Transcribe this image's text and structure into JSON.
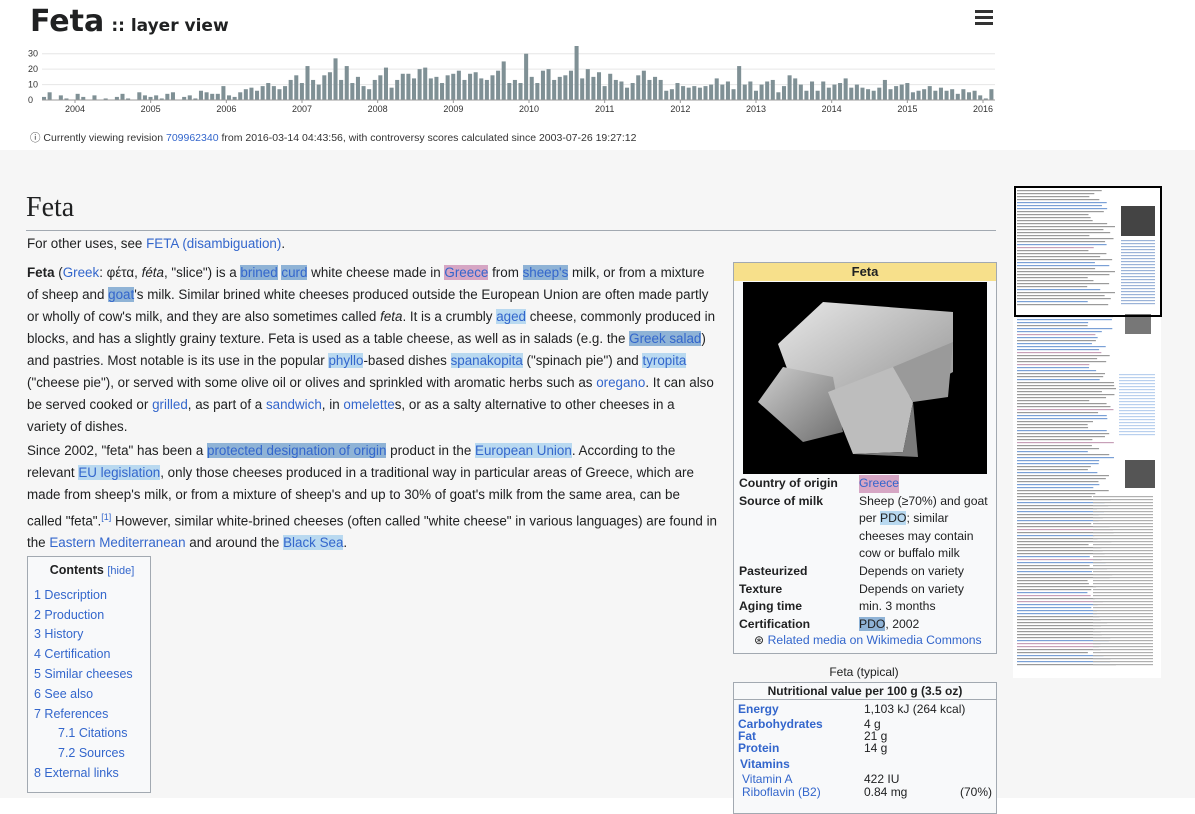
{
  "header": {
    "title": "Feta",
    "subtitle": ":: layer view",
    "menu_icon": "hamburger-menu-icon",
    "revision": {
      "info_icon": "ⓘ",
      "prefix": "Currently viewing revision",
      "id": "709962340",
      "suffix": "from 2016-03-14 04:43:56, with controversy scores calculated since 2003-07-26 19:27:12"
    }
  },
  "chart_data": {
    "type": "bar",
    "ylim": [
      0,
      35
    ],
    "y_ticks": [
      "30",
      "20",
      "10",
      "0"
    ],
    "x_ticks": [
      "2004",
      "2005",
      "2006",
      "2007",
      "2008",
      "2009",
      "2010",
      "2011",
      "2012",
      "2013",
      "2014",
      "2015",
      "2016"
    ],
    "bar_color": "#7f9095",
    "grid": true,
    "values": [
      2,
      5,
      0,
      3,
      1,
      0,
      4,
      2,
      0,
      3,
      0,
      1,
      0,
      2,
      4,
      1,
      0,
      5,
      3,
      2,
      3,
      1,
      4,
      5,
      0,
      2,
      3,
      1,
      6,
      5,
      4,
      4,
      9,
      3,
      2,
      5,
      7,
      8,
      6,
      9,
      11,
      9,
      7,
      9,
      13,
      16,
      11,
      22,
      13,
      10,
      16,
      18,
      27,
      13,
      22,
      11,
      15,
      9,
      7,
      13,
      16,
      21,
      8,
      13,
      17,
      17,
      14,
      20,
      21,
      14,
      15,
      11,
      16,
      17,
      19,
      13,
      17,
      18,
      14,
      13,
      16,
      19,
      25,
      11,
      13,
      11,
      30,
      15,
      11,
      19,
      20,
      13,
      15,
      16,
      19,
      35,
      14,
      20,
      15,
      18,
      9,
      17,
      13,
      12,
      8,
      11,
      16,
      19,
      13,
      15,
      13,
      6,
      7,
      11,
      9,
      8,
      9,
      8,
      9,
      10,
      14,
      10,
      12,
      7,
      22,
      10,
      12,
      6,
      10,
      12,
      13,
      5,
      9,
      16,
      14,
      10,
      6,
      12,
      6,
      12,
      8,
      10,
      11,
      14,
      8,
      10,
      8,
      7,
      6,
      8,
      13,
      7,
      9,
      10,
      11,
      5,
      6,
      7,
      9,
      6,
      8,
      6,
      7,
      4,
      7,
      5,
      6,
      3,
      1,
      7
    ]
  },
  "article": {
    "title": "Feta",
    "hatnote_prefix": "For other uses, see",
    "hatnote_link": "FETA (disambiguation)",
    "hatnote_end": "."
  },
  "toc": {
    "title": "Contents",
    "hide": "[hide]",
    "items": [
      "1 Description",
      "2 Production",
      "3 History",
      "4 Certification",
      "5 Similar cheeses",
      "6 See also",
      "7 References",
      "7.1 Citations",
      "7.2 Sources",
      "8 External links"
    ]
  },
  "infobox": {
    "title": "Feta",
    "rows": [
      {
        "k": "Country of origin",
        "v": "Greece"
      },
      {
        "k": "Source of milk",
        "v": "Sheep (≥70%) and goat per PDO; similar cheeses may contain cow or buffalo milk"
      },
      {
        "k": "Pasteurized",
        "v": "Depends on variety"
      },
      {
        "k": "Texture",
        "v": "Depends on variety"
      },
      {
        "k": "Aging time",
        "v": "min. 3 months"
      },
      {
        "k": "Certification",
        "v": "PDO, 2002"
      }
    ],
    "commons": "Related media on Wikimedia Commons"
  },
  "nutrition": {
    "caption": "Feta (typical)",
    "header": "Nutritional value per 100 g (3.5 oz)",
    "rows": [
      {
        "k": "Energy",
        "v": "1,103 kJ (264 kcal)",
        "p": ""
      },
      {
        "k": "Carbohydrates",
        "v": "4 g",
        "p": ""
      },
      {
        "k": "Fat",
        "v": "21 g",
        "p": ""
      },
      {
        "k": "Protein",
        "v": "14 g",
        "p": ""
      },
      {
        "k": "Vitamins",
        "v": "",
        "p": ""
      },
      {
        "k": "Vitamin A",
        "v": "422 IU",
        "p": ""
      },
      {
        "k": "Riboflavin (B2)",
        "v": "0.84 mg",
        "p": "(70%)"
      }
    ]
  }
}
